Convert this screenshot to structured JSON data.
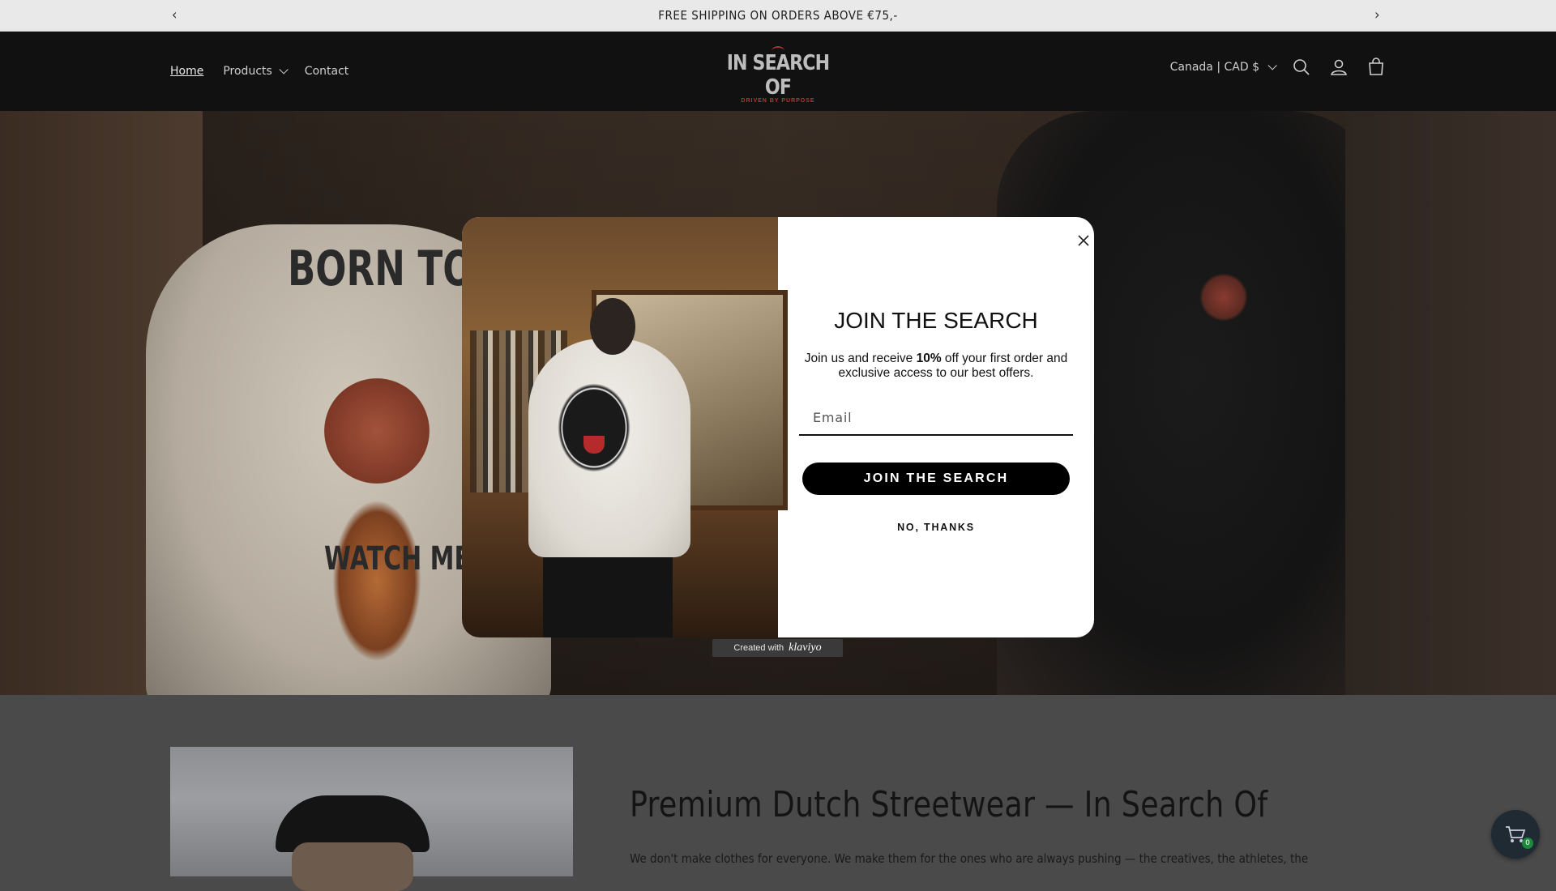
{
  "announcement": {
    "text": "FREE SHIPPING ON ORDERS ABOVE €75,-",
    "prev_icon": "chevron-left-icon",
    "next_icon": "chevron-right-icon"
  },
  "header": {
    "nav": [
      {
        "label": "Home",
        "active": true
      },
      {
        "label": "Products",
        "has_dropdown": true
      },
      {
        "label": "Contact"
      }
    ],
    "logo": {
      "text": "IN SEARCH OF",
      "tagline": "DRIVEN BY PURPOSE"
    },
    "currency": "Canada | CAD $",
    "icons": [
      "search-icon",
      "account-icon",
      "cart-icon"
    ]
  },
  "popup": {
    "title": "JOIN THE SEARCH",
    "desc_before": "Join us and receive ",
    "desc_bold": "10%",
    "desc_after": " off your first order and exclusive access to our best offers.",
    "email_placeholder": "Email",
    "submit_label": "JOIN THE SEARCH",
    "decline_label": "NO, THANKS",
    "close_icon": "close-icon"
  },
  "klaviyo_badge": {
    "prefix": "Created with",
    "brand": "klaviyo"
  },
  "hero": {
    "left_print_top": "BORN TO L",
    "left_print_bottom": "WATCH ME B"
  },
  "section": {
    "heading": "Premium Dutch Streetwear — In Search Of",
    "body": "We don't make clothes for everyone. We make them for the ones who are always pushing — the creatives, the athletes, the"
  },
  "cart_fab": {
    "count": "0"
  },
  "colors": {
    "header_bg": "#111111",
    "button_bg": "#000000",
    "popup_bg": "#ffffff",
    "badge_green": "#1b8a3c"
  }
}
